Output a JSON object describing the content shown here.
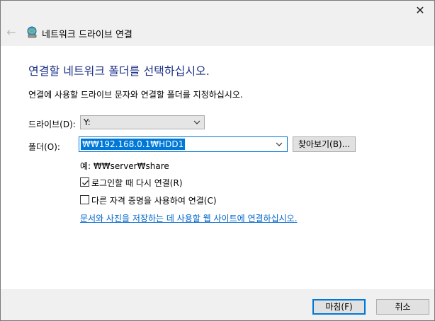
{
  "window": {
    "title": "네트워크 드라이브 연결"
  },
  "content": {
    "heading": "연결할 네트워크 폴더를 선택하십시오.",
    "instruction": "연결에 사용할 드라이브 문자와 연결할 폴더를 지정하십시오.",
    "drive_label": "드라이브(D):",
    "drive_value": "Y:",
    "folder_label": "폴더(O):",
    "folder_value": "₩₩192.168.0.1₩HDD1",
    "browse_label": "찾아보기(B)...",
    "example": "예: ₩₩server₩share",
    "reconnect_label": "로그인할 때 다시 연결(R)",
    "reconnect_checked": true,
    "credentials_label": "다른 자격 증명을 사용하여 연결(C)",
    "credentials_checked": false,
    "link_text": "문서와 사진을 저장하는 데 사용할 웹 사이트에 연결하십시오."
  },
  "footer": {
    "finish_label": "마침(F)",
    "cancel_label": "취소"
  },
  "colors": {
    "heading": "#1e3287",
    "link": "#0066cc",
    "accent": "#0078d7"
  }
}
